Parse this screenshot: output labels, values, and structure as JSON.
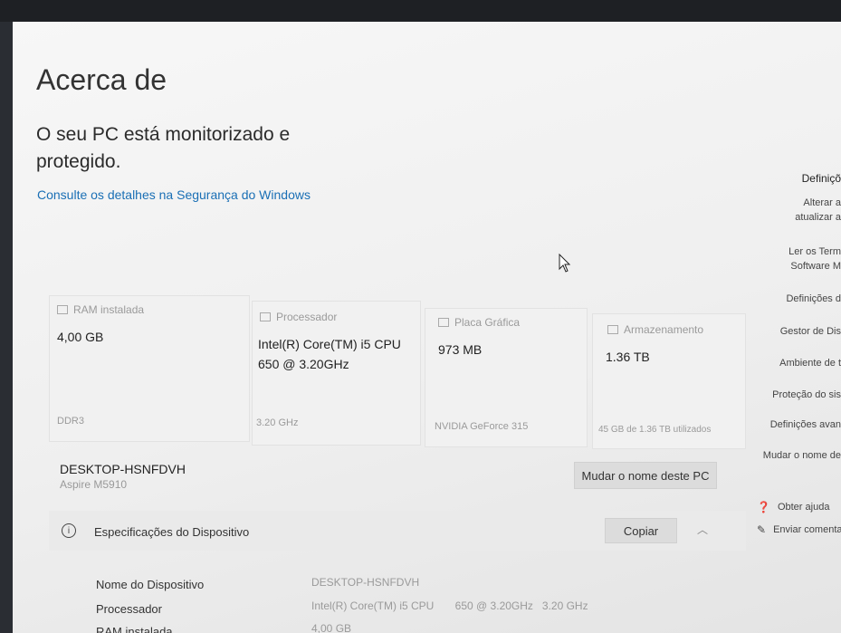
{
  "page": {
    "title": "Acerca de",
    "protection_text": "O seu PC está monitorizado e protegido.",
    "security_link": "Consulte os detalhes na Segurança do Windows"
  },
  "cards": [
    {
      "label": "RAM instalada",
      "icon": "ram-icon",
      "value": "4,00 GB",
      "sub": "DDR3"
    },
    {
      "label": "Processador",
      "icon": "processor-icon",
      "value": "Intel(R) Core(TM) i5 CPU 650 @ 3.20GHz",
      "sub": "3.20 GHz"
    },
    {
      "label": "Placa Gráfica",
      "icon": "graphics-card-icon",
      "value": "973 MB",
      "sub": "NVIDIA GeForce 315"
    },
    {
      "label": "Armazenamento",
      "icon": "storage-icon",
      "value": "1.36 TB",
      "sub": "45 GB de 1.36 TB utilizados"
    }
  ],
  "device": {
    "name": "DESKTOP-HSNFDVH",
    "model": "Aspire M5910",
    "rename_button": "Mudar o nome deste PC"
  },
  "specs": {
    "heading": "Especificações do Dispositivo",
    "copy_button": "Copiar",
    "rows": [
      {
        "label": "Nome do Dispositivo",
        "value": "DESKTOP-HSNFDVH"
      },
      {
        "label": "Processador",
        "value": "Intel(R) Core(TM) i5 CPU       650 @ 3.20GHz   3.20 GHz"
      },
      {
        "label": "RAM instalada",
        "value": "4,00 GB"
      }
    ]
  },
  "sidebar": {
    "items": [
      {
        "label": "Definiçõ"
      },
      {
        "label": "Alterar a"
      },
      {
        "label": "atualizar a"
      },
      {
        "label": "Ler os Term"
      },
      {
        "label": "Software M"
      },
      {
        "label": "Definições d"
      },
      {
        "label": "Gestor de Dis"
      },
      {
        "label": "Ambiente de t"
      },
      {
        "label": "Proteção do sis"
      },
      {
        "label": "Definições avan"
      },
      {
        "label": "Mudar o nome de"
      },
      {
        "label": "Obter ajuda"
      },
      {
        "label": "Enviar comenta"
      }
    ]
  }
}
